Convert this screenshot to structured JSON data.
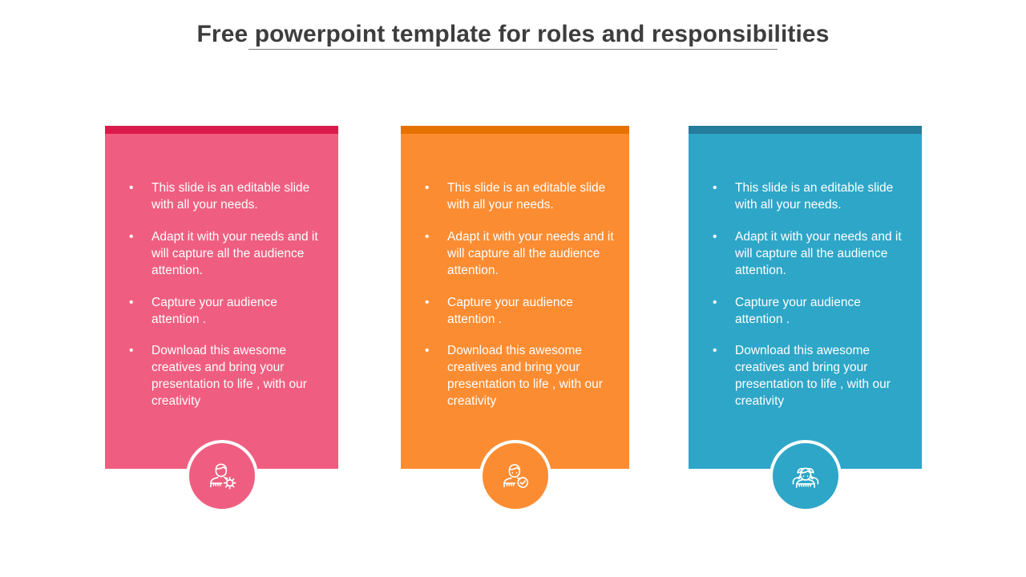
{
  "title": "Free powerpoint template for roles and responsibilities",
  "divider": true,
  "bullet_glyph": "•",
  "cards": [
    {
      "id": "card-pink",
      "accent_color": "#db1a4c",
      "body_color": "#ef5e80",
      "icon": "user-gear-icon",
      "bullets": [
        "This slide is an editable slide with  all your needs.",
        "Adapt it with your needs and it will capture all the audience attention.",
        "Capture your audience attention .",
        "Download this awesome creatives and bring your presentation to life , with our creativity"
      ]
    },
    {
      "id": "card-orange",
      "accent_color": "#e57200",
      "body_color": "#fc8c32",
      "icon": "user-check-icon",
      "bullets": [
        "This slide is an editable slide with  all your needs.",
        "Adapt it with your needs and it will capture all the audience attention.",
        "Capture your audience attention .",
        "Download this awesome creatives and bring your presentation to life , with our creativity"
      ]
    },
    {
      "id": "card-blue",
      "accent_color": "#247d9b",
      "body_color": "#2ea6c8",
      "icon": "user-group-icon",
      "bullets": [
        "This slide is an editable slide with  all your needs.",
        "Adapt it with your needs and it will capture all the audience attention.",
        "Capture your audience attention .",
        "Download this awesome creatives and bring your presentation to life , with our creativity"
      ]
    }
  ]
}
